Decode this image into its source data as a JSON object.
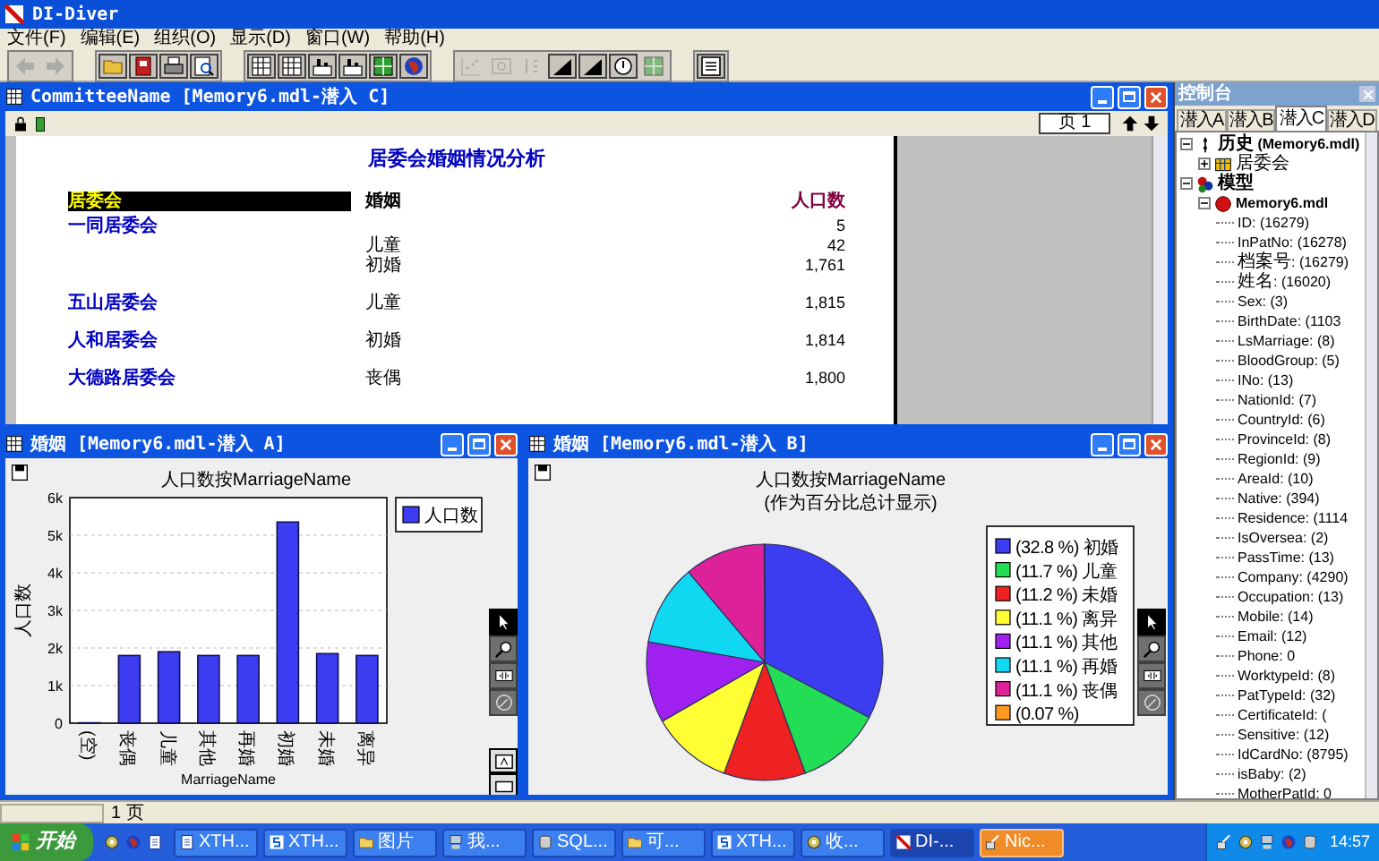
{
  "app": {
    "title": "DI-Diver"
  },
  "menu": [
    "文件(F)",
    "编辑(E)",
    "组织(O)",
    "显示(D)",
    "窗口(W)",
    "帮助(H)"
  ],
  "toolbar": [
    [
      {
        "kind": "back",
        "disabled": true
      },
      {
        "kind": "forward",
        "disabled": true
      }
    ],
    [
      {
        "kind": "open",
        "disabled": false
      },
      {
        "kind": "book",
        "disabled": false
      },
      {
        "kind": "print",
        "disabled": false
      },
      {
        "kind": "preview",
        "disabled": false
      }
    ],
    [
      {
        "kind": "table",
        "disabled": false
      },
      {
        "kind": "table",
        "disabled": false
      },
      {
        "kind": "bartable",
        "disabled": false
      },
      {
        "kind": "bartable",
        "disabled": false
      },
      {
        "kind": "grid",
        "disabled": false
      },
      {
        "kind": "globe",
        "disabled": false
      }
    ],
    [
      {
        "kind": "scatter",
        "disabled": true
      },
      {
        "kind": "picture",
        "disabled": true
      },
      {
        "kind": "dots",
        "disabled": true
      },
      {
        "kind": "area",
        "disabled": false
      },
      {
        "kind": "area",
        "disabled": false
      },
      {
        "kind": "circle",
        "disabled": false
      },
      {
        "kind": "grid",
        "disabled": true
      }
    ],
    [
      {
        "kind": "list",
        "disabled": false
      }
    ]
  ],
  "report_window": {
    "title": "CommitteeName [Memory6.mdl-潜入 C]",
    "page_field": {
      "value": "页 1"
    },
    "report_title": "居委会婚姻情况分析",
    "columns": [
      "居委会",
      "婚姻",
      "人口数"
    ],
    "groups": [
      {
        "committee": "一同居委会",
        "lines": [
          {
            "count": "5"
          },
          {
            "marriage": "儿童",
            "count": "42"
          },
          {
            "marriage": "初婚",
            "count": "1,761"
          }
        ]
      },
      {
        "committee": "五山居委会",
        "lines": [
          {
            "marriage": "儿童",
            "count": "1,815"
          }
        ]
      },
      {
        "committee": "人和居委会",
        "lines": [
          {
            "marriage": "初婚",
            "count": "1,814"
          }
        ]
      },
      {
        "committee": "大德路居委会",
        "lines": [
          {
            "marriage": "丧偶",
            "count": "1,800"
          }
        ]
      }
    ]
  },
  "bar_window": {
    "title": "婚姻 [Memory6.mdl-潜入 A]",
    "chart_data": {
      "type": "bar",
      "title": "人口数按MarriageName",
      "xlabel": "MarriageName",
      "ylabel": "人口数",
      "categories": [
        "(空)",
        "丧偶",
        "儿童",
        "其他",
        "再婚",
        "初婚",
        "未婚",
        "离异"
      ],
      "series": [
        {
          "name": "人口数",
          "color": "#3c3cf0",
          "values": [
            10,
            1800,
            1900,
            1800,
            1800,
            5350,
            1850,
            1800
          ]
        }
      ],
      "grid": true,
      "legend": true,
      "ylim": [
        0,
        6000
      ],
      "yticks": [
        {
          "value": 0,
          "label": "0"
        },
        {
          "value": 1000,
          "label": "1k"
        },
        {
          "value": 2000,
          "label": "2k"
        },
        {
          "value": 3000,
          "label": "3k"
        },
        {
          "value": 4000,
          "label": "4k"
        },
        {
          "value": 5000,
          "label": "5k"
        },
        {
          "value": 6000,
          "label": "6k"
        }
      ]
    },
    "tools": [
      {
        "kind": "pointer",
        "selected": true
      },
      {
        "kind": "zoom",
        "selected": false
      },
      {
        "kind": "scroll",
        "selected": false
      },
      {
        "kind": "rotate",
        "selected": false
      }
    ],
    "layout_tools": [
      {
        "kind": "textframe"
      },
      {
        "kind": "frame"
      }
    ]
  },
  "pie_window": {
    "title": "婚姻 [Memory6.mdl-潜入 B]",
    "subtitle": "(作为百分比总计显示)",
    "chart_data": {
      "type": "pie",
      "title": "人口数按MarriageName",
      "categories": [
        "(32.8 %) 初婚",
        "(11.7 %) 儿童",
        "(11.2 %) 未婚",
        "(11.1 %) 离异",
        "(11.1 %) 其他",
        "(11.1 %) 再婚",
        "(11.1 %) 丧偶",
        "(0.07 %)"
      ],
      "values": [
        32.8,
        11.7,
        11.2,
        11.1,
        11.1,
        11.1,
        11.1,
        0.07
      ],
      "legend": true
    },
    "legend": [
      {
        "color": "#3c3cf0"
      },
      {
        "color": "#22dd55"
      },
      {
        "color": "#ee2222"
      },
      {
        "color": "#ffff33"
      },
      {
        "color": "#a020f0"
      },
      {
        "color": "#10d8f0"
      },
      {
        "color": "#dd2299"
      },
      {
        "color": "#ff9922"
      }
    ],
    "tools": [
      {
        "kind": "pointer",
        "selected": true
      },
      {
        "kind": "zoom",
        "selected": false
      },
      {
        "kind": "scroll",
        "selected": false
      },
      {
        "kind": "rotate",
        "selected": false
      }
    ]
  },
  "console": {
    "title": "控制台",
    "tabs": [
      {
        "label": "潜入A",
        "selected": false
      },
      {
        "label": "潜入B",
        "selected": false
      },
      {
        "label": "潜入C",
        "selected": true
      },
      {
        "label": "潜入D",
        "selected": false
      }
    ],
    "tree": [
      {
        "kind": "history",
        "label": "历史 (Memory6.mdl)",
        "expanded": true,
        "children": [
          {
            "kind": "table",
            "label": "居委会",
            "expanded": false
          }
        ]
      },
      {
        "kind": "model",
        "label": "模型",
        "expanded": true,
        "children": [
          {
            "kind": "file",
            "label": "Memory6.mdl",
            "expanded": true,
            "children": [
              {
                "kind": "field",
                "label": "ID: (16279)"
              },
              {
                "kind": "field",
                "label": "InPatNo: (16278)"
              },
              {
                "kind": "field",
                "label": "档案号: (16279)"
              },
              {
                "kind": "field",
                "label": "姓名: (16020)"
              },
              {
                "kind": "field",
                "label": "Sex: (3)"
              },
              {
                "kind": "field",
                "label": "BirthDate: (1103"
              },
              {
                "kind": "field",
                "label": "LsMarriage: (8)"
              },
              {
                "kind": "field",
                "label": "BloodGroup: (5)"
              },
              {
                "kind": "field",
                "label": "INo: (13)"
              },
              {
                "kind": "field",
                "label": "NationId: (7)"
              },
              {
                "kind": "field",
                "label": "CountryId: (6)"
              },
              {
                "kind": "field",
                "label": "ProvinceId: (8)"
              },
              {
                "kind": "field",
                "label": "RegionId: (9)"
              },
              {
                "kind": "field",
                "label": "AreaId: (10)"
              },
              {
                "kind": "field",
                "label": "Native: (394)"
              },
              {
                "kind": "field",
                "label": "Residence: (1114"
              },
              {
                "kind": "field",
                "label": "IsOversea: (2)"
              },
              {
                "kind": "field",
                "label": "PassTime: (13)"
              },
              {
                "kind": "field",
                "label": "Company: (4290)"
              },
              {
                "kind": "field",
                "label": "Occupation: (13)"
              },
              {
                "kind": "field",
                "label": "Mobile: (14)"
              },
              {
                "kind": "field",
                "label": "Email: (12)"
              },
              {
                "kind": "field",
                "label": "Phone: 0"
              },
              {
                "kind": "field",
                "label": "WorktypeId: (8)"
              },
              {
                "kind": "field",
                "label": "PatTypeId: (32)"
              },
              {
                "kind": "field",
                "label": "CertificateId: ("
              },
              {
                "kind": "field",
                "label": "Sensitive: (12)"
              },
              {
                "kind": "field",
                "label": "IdCardNo: (8795)"
              },
              {
                "kind": "field",
                "label": "isBaby: (2)"
              },
              {
                "kind": "field",
                "label": "MotherPatId: 0"
              }
            ]
          }
        ]
      }
    ]
  },
  "status_bar": {
    "page": "1 页"
  },
  "taskbar": {
    "start": "开始",
    "tasks": [
      {
        "kind": "word",
        "label": "XTH...",
        "selected": false,
        "flashing": false
      },
      {
        "kind": "xth",
        "label": "XTH...",
        "selected": false,
        "flashing": false
      },
      {
        "kind": "folder",
        "label": "图片",
        "selected": false,
        "flashing": false
      },
      {
        "kind": "computer",
        "label": "我...",
        "selected": false,
        "flashing": false
      },
      {
        "kind": "sql",
        "label": "SQL...",
        "selected": false,
        "flashing": false
      },
      {
        "kind": "folder",
        "label": "可...",
        "selected": false,
        "flashing": false
      },
      {
        "kind": "xth",
        "label": "XTH...",
        "selected": false,
        "flashing": false
      },
      {
        "kind": "settings",
        "label": "收...",
        "selected": false,
        "flashing": false
      },
      {
        "kind": "di",
        "label": "DI-...",
        "selected": true,
        "flashing": false
      },
      {
        "kind": "network",
        "label": "Nic...",
        "selected": false,
        "flashing": true
      }
    ],
    "clock": "14:57"
  }
}
